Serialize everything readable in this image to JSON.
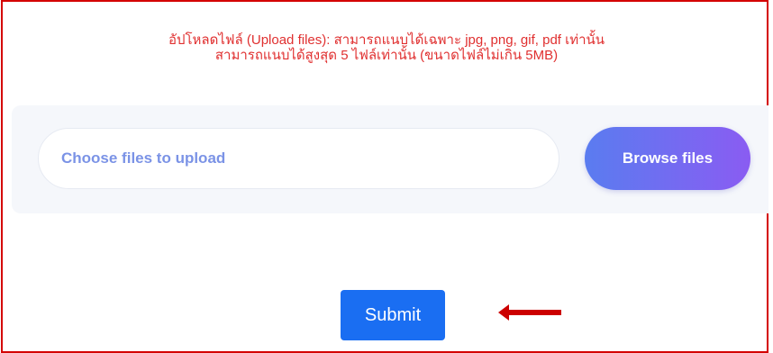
{
  "notice": {
    "line1": "อัปโหลดไฟล์ (Upload files): สามารถแนบได้เฉพาะ jpg, png, gif, pdf เท่านั้น",
    "line2": "สามารถแนบได้สูงสุด 5 ไฟล์เท่านั้น (ขนาดไฟล์ไม่เกิน 5MB)"
  },
  "upload": {
    "placeholder": "Choose files to upload",
    "browse_label": "Browse files"
  },
  "form": {
    "submit_label": "Submit"
  },
  "colors": {
    "frame_border": "#d40000",
    "notice_text": "#e03030",
    "placeholder_text": "#7b93e6",
    "browse_gradient_start": "#5a7cf0",
    "browse_gradient_end": "#8a5cf2",
    "submit_bg": "#1a6ef2",
    "arrow": "#cc0000"
  },
  "icons": {
    "annotation": "left-arrow-icon"
  }
}
